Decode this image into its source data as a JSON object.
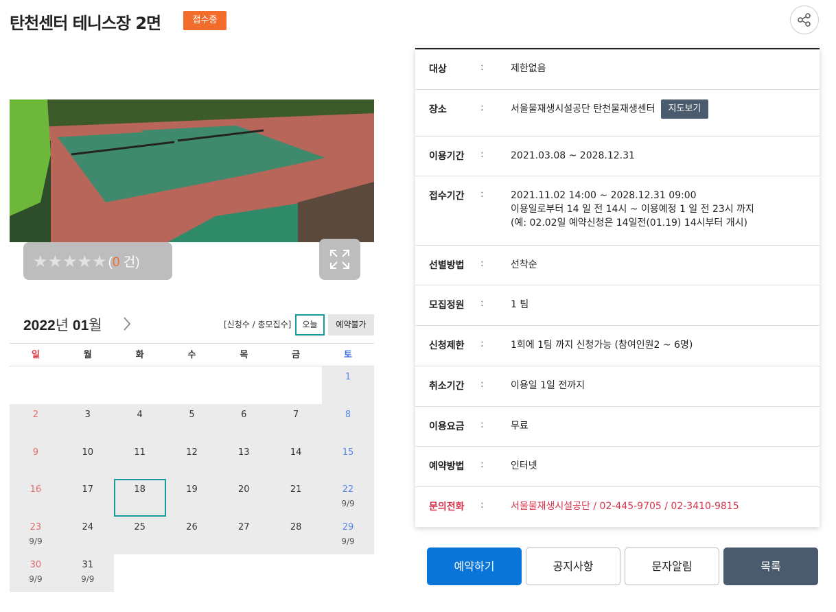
{
  "header": {
    "title": "탄천센터 테니스장 2면",
    "status": "접수중",
    "share_icon": "share-icon"
  },
  "photo": {
    "rating_stars": 0,
    "stars_text": "★★★★★",
    "rating_open": "(",
    "rating_count": "0",
    "rating_close": " 건)",
    "expand_icon": "expand-icon"
  },
  "calendar": {
    "year": "2022",
    "year_unit": "년",
    "month": "01",
    "month_unit": "월",
    "next_icon": "chevron-right-icon",
    "legend": "[신청수 / 총모집수]",
    "today_label": "오늘",
    "unavailable_label": "예약불가",
    "weekdays": [
      "일",
      "월",
      "화",
      "수",
      "목",
      "금",
      "토"
    ],
    "weeks": [
      [
        {
          "d": ""
        },
        {
          "d": ""
        },
        {
          "d": ""
        },
        {
          "d": ""
        },
        {
          "d": ""
        },
        {
          "d": ""
        },
        {
          "d": "1",
          "active": true
        }
      ],
      [
        {
          "d": "2",
          "active": true
        },
        {
          "d": "3",
          "active": true
        },
        {
          "d": "4",
          "active": true
        },
        {
          "d": "5",
          "active": true
        },
        {
          "d": "6",
          "active": true
        },
        {
          "d": "7",
          "active": true
        },
        {
          "d": "8",
          "active": true
        }
      ],
      [
        {
          "d": "9",
          "active": true
        },
        {
          "d": "10",
          "active": true
        },
        {
          "d": "11",
          "active": true
        },
        {
          "d": "12",
          "active": true
        },
        {
          "d": "13",
          "active": true
        },
        {
          "d": "14",
          "active": true
        },
        {
          "d": "15",
          "active": true
        }
      ],
      [
        {
          "d": "16",
          "active": true
        },
        {
          "d": "17",
          "active": true
        },
        {
          "d": "18",
          "active": true,
          "today": true
        },
        {
          "d": "19",
          "active": true
        },
        {
          "d": "20",
          "active": true
        },
        {
          "d": "21",
          "active": true
        },
        {
          "d": "22",
          "active": true,
          "cnt": "9/9"
        }
      ],
      [
        {
          "d": "23",
          "active": true,
          "cnt": "9/9"
        },
        {
          "d": "24",
          "active": true
        },
        {
          "d": "25",
          "active": true
        },
        {
          "d": "26",
          "active": true
        },
        {
          "d": "27",
          "active": true
        },
        {
          "d": "28",
          "active": true
        },
        {
          "d": "29",
          "active": true,
          "cnt": "9/9"
        }
      ],
      [
        {
          "d": "30",
          "active": true,
          "cnt": "9/9"
        },
        {
          "d": "31",
          "active": true,
          "cnt": "9/9"
        },
        {
          "d": ""
        },
        {
          "d": ""
        },
        {
          "d": ""
        },
        {
          "d": ""
        },
        {
          "d": ""
        }
      ]
    ]
  },
  "info": {
    "colon": ":",
    "map_label": "지도보기",
    "rows": [
      {
        "label": "대상",
        "lines": [
          "제한없음"
        ]
      },
      {
        "label": "장소",
        "lines": [
          "서울물재생시설공단 탄천물재생센터"
        ],
        "map": true
      },
      {
        "label": "이용기간",
        "lines": [
          "2021.03.08 ~ 2028.12.31"
        ]
      },
      {
        "label": "접수기간",
        "lines": [
          "2021.11.02 14:00 ~ 2028.12.31 09:00",
          "이용일로부터 14 일 전 14시 ~ 이용예정 1 일 전 23시 까지",
          "(예: 02.02일 예약신청은 14일전(01.19) 14시부터 개시)"
        ]
      },
      {
        "label": "선별방법",
        "lines": [
          "선착순"
        ]
      },
      {
        "label": "모집정원",
        "lines": [
          "1 팀"
        ]
      },
      {
        "label": "신청제한",
        "lines": [
          "1회에 1팀 까지 신청가능 (참여인원2 ~ 6명)"
        ]
      },
      {
        "label": "취소기간",
        "lines": [
          "이용일 1일 전까지"
        ]
      },
      {
        "label": "이용요금",
        "lines": [
          "무료"
        ]
      },
      {
        "label": "예약방법",
        "lines": [
          "인터넷"
        ]
      },
      {
        "label": "문의전화",
        "lines": [
          "서울물재생시설공단 / 02-445-9705 / 02-3410-9815"
        ],
        "red": true
      }
    ]
  },
  "actions": {
    "reserve": "예약하기",
    "notice": "공지사항",
    "sms": "문자알림",
    "list": "목록"
  },
  "colors": {
    "accent_orange": "#f26c2c",
    "primary_blue": "#0a75d8",
    "dark_slate": "#4b5b6e",
    "today_teal": "#179b9b",
    "alert_red": "#d6334b"
  }
}
